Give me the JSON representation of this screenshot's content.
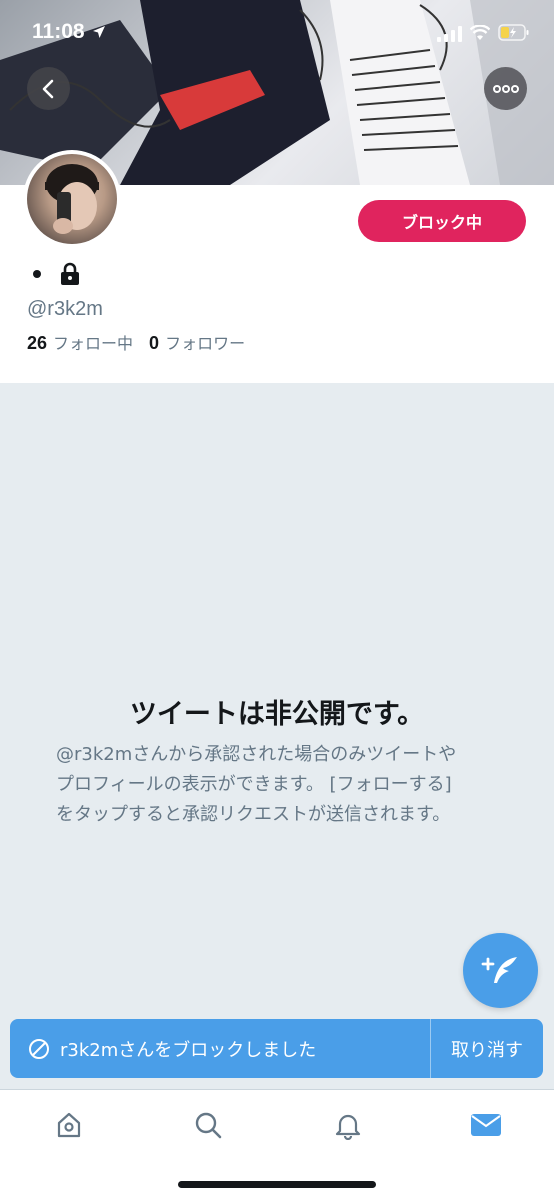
{
  "status": {
    "time": "11:08"
  },
  "profile": {
    "block_label": "ブロック中",
    "handle": "@r3k2m",
    "following_count": "26",
    "following_label": "フォロー中",
    "followers_count": "0",
    "followers_label": "フォロワー"
  },
  "empty_state": {
    "title": "ツイートは非公開です。",
    "body": "@r3k2mさんから承認された場合のみツイートや\nプロフィールの表示ができます。 [フォローする]\nをタップすると承認リクエストが送信されます。"
  },
  "toast": {
    "message": "r3k2mさんをブロックしました",
    "undo_label": "取り消す"
  },
  "tabs": [
    "home-icon",
    "search-icon",
    "notifications-icon",
    "messages-icon"
  ],
  "colors": {
    "accent": "#4a9ee8",
    "block": "#e0245e",
    "background": "#e6ecf0"
  }
}
